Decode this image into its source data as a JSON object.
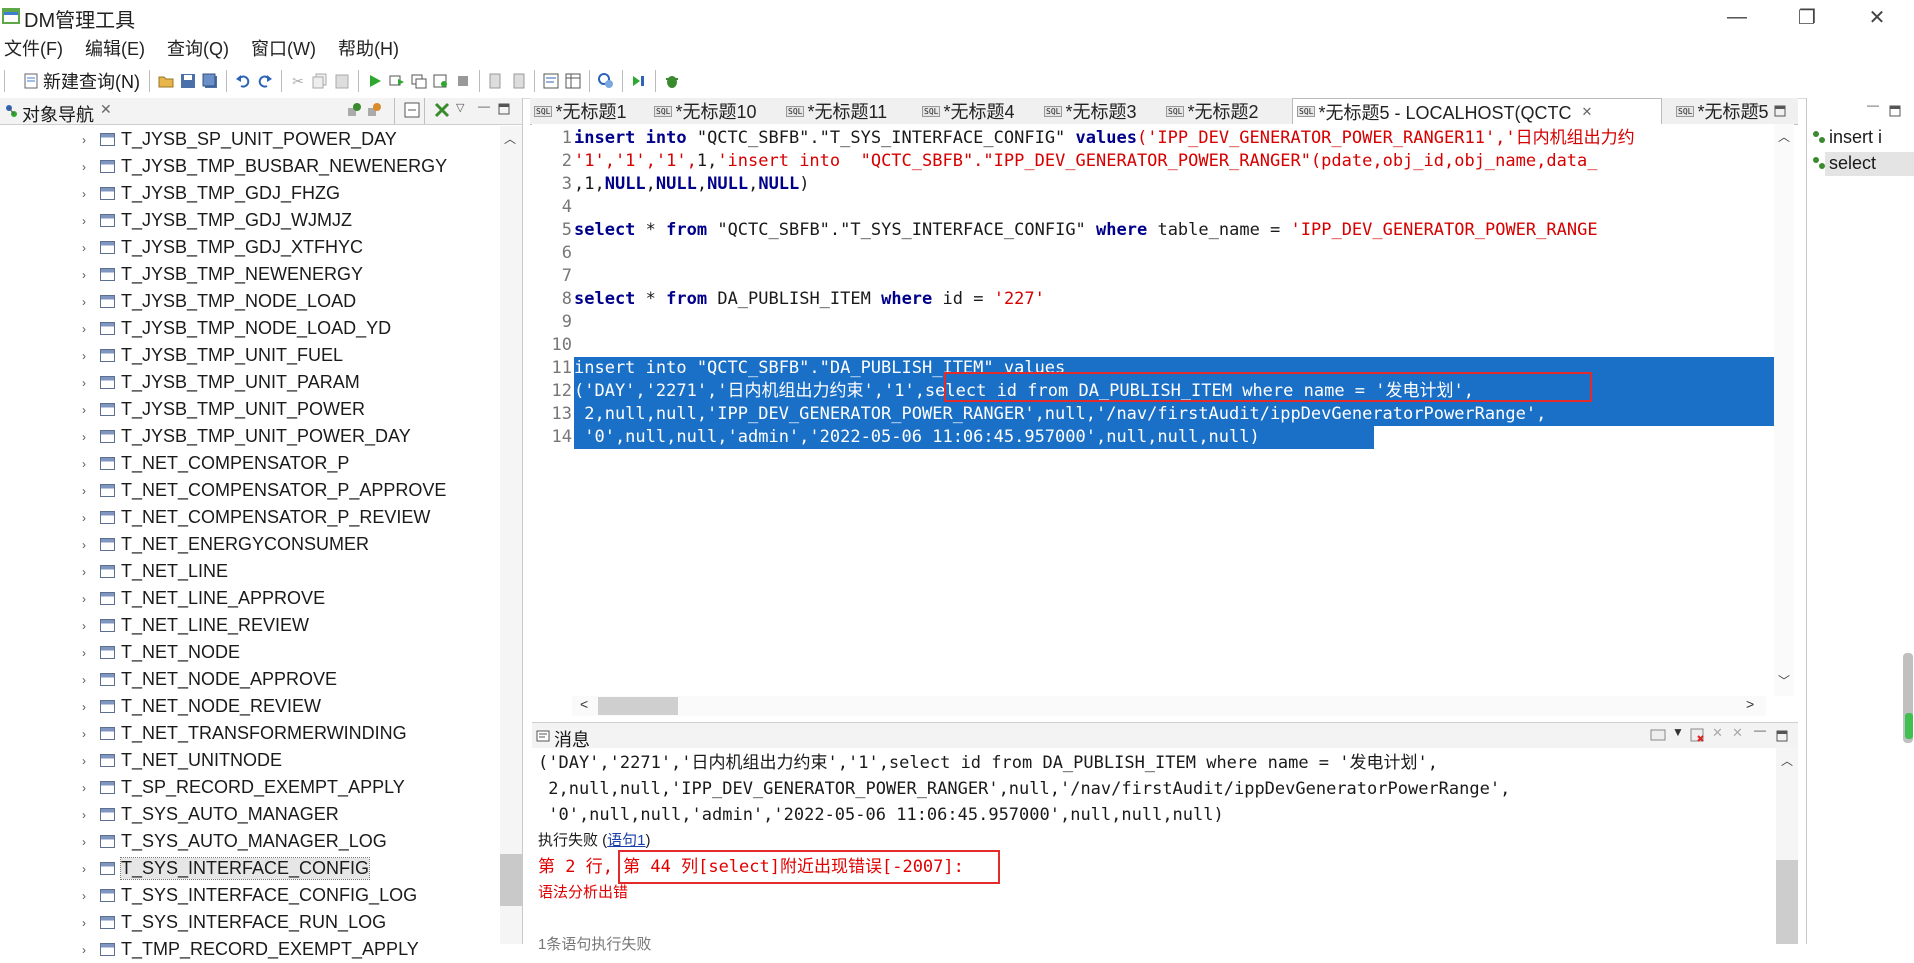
{
  "window": {
    "title": "DM管理工具",
    "controls": [
      "—",
      "❐",
      "✕"
    ]
  },
  "menu": [
    "文件(F)",
    "编辑(E)",
    "查询(Q)",
    "窗口(W)",
    "帮助(H)"
  ],
  "toolbar": {
    "new_query": "新建查询(N)"
  },
  "navigator": {
    "title": "对象导航",
    "items": [
      "T_JYSB_SP_UNIT_POWER_DAY",
      "T_JYSB_TMP_BUSBAR_NEWENERGY",
      "T_JYSB_TMP_GDJ_FHZG",
      "T_JYSB_TMP_GDJ_WJMJZ",
      "T_JYSB_TMP_GDJ_XTFHYC",
      "T_JYSB_TMP_NEWENERGY",
      "T_JYSB_TMP_NODE_LOAD",
      "T_JYSB_TMP_NODE_LOAD_YD",
      "T_JYSB_TMP_UNIT_FUEL",
      "T_JYSB_TMP_UNIT_PARAM",
      "T_JYSB_TMP_UNIT_POWER",
      "T_JYSB_TMP_UNIT_POWER_DAY",
      "T_NET_COMPENSATOR_P",
      "T_NET_COMPENSATOR_P_APPROVE",
      "T_NET_COMPENSATOR_P_REVIEW",
      "T_NET_ENERGYCONSUMER",
      "T_NET_LINE",
      "T_NET_LINE_APPROVE",
      "T_NET_LINE_REVIEW",
      "T_NET_NODE",
      "T_NET_NODE_APPROVE",
      "T_NET_NODE_REVIEW",
      "T_NET_TRANSFORMERWINDING",
      "T_NET_UNITNODE",
      "T_SP_RECORD_EXEMPT_APPLY",
      "T_SYS_AUTO_MANAGER",
      "T_SYS_AUTO_MANAGER_LOG",
      "T_SYS_INTERFACE_CONFIG",
      "T_SYS_INTERFACE_CONFIG_LOG",
      "T_SYS_INTERFACE_RUN_LOG",
      "T_TMP_RECORD_EXEMPT_APPLY"
    ],
    "selected_item": "T_SYS_INTERFACE_CONFIG"
  },
  "tabs": [
    "*无标题1",
    "*无标题10",
    "*无标题11",
    "*无标题4",
    "*无标题3",
    "*无标题2",
    "*无标题5 - LOCALHOST(QCTC",
    "*无标题5"
  ],
  "active_tab": "*无标题5 - LOCALHOST(QCTC",
  "editor": {
    "line_numbers": [
      "1",
      "2",
      "3",
      "4",
      "5",
      "6",
      "7",
      "8",
      "9",
      "10",
      "11",
      "12",
      "13",
      "14"
    ],
    "l1": {
      "kw1": "insert into",
      "t1": " \"QCTC_SBFB\".\"T_SYS_INTERFACE_CONFIG\" ",
      "kw2": "values",
      "s1": "('IPP_DEV_GENERATOR_POWER_RANGER11','日内机组出力约"
    },
    "l2": {
      "s1": "'1','1','1',",
      "t1": "1,",
      "s2": "'insert into  \"QCTC_SBFB\".\"IPP_DEV_GENERATOR_POWER_RANGER\"(pdate,obj_id,obj_name,data_"
    },
    "l3": {
      "t1": ",1,",
      "kw1": "NULL",
      "t2": ",",
      "kw2": "NULL",
      "t3": ",",
      "kw3": "NULL",
      "t4": ",",
      "kw4": "NULL",
      "t5": ")"
    },
    "l5": {
      "kw1": "select",
      "t1": " * ",
      "kw2": "from",
      "t2": " \"QCTC_SBFB\".\"T_SYS_INTERFACE_CONFIG\" ",
      "kw3": "where",
      "t3": " table_name = ",
      "s1": "'IPP_DEV_GENERATOR_POWER_RANGE"
    },
    "l8": {
      "kw1": "select",
      "t1": " * ",
      "kw2": "from",
      "t2": " DA_PUBLISH_ITEM ",
      "kw3": "where",
      "t3": " id = ",
      "s1": "'227'"
    },
    "l11": "insert into \"QCTC_SBFB\".\"DA_PUBLISH_ITEM\" values",
    "l12": "('DAY','2271','日内机组出力约束','1',select id from DA_PUBLISH_ITEM where name = '发电计划',",
    "l13": " 2,null,null,'IPP_DEV_GENERATOR_POWER_RANGER',null,'/nav/firstAudit/ippDevGeneratorPowerRange',",
    "l14": " '0',null,null,'admin','2022-05-06 11:06:45.957000',null,null,null)"
  },
  "messages": {
    "title": "消息",
    "lines": [
      "('DAY','2271','日内机组出力约束','1',select id from DA_PUBLISH_ITEM where name = '发电计划',",
      " 2,null,null,'IPP_DEV_GENERATOR_POWER_RANGER',null,'/nav/firstAudit/ippDevGeneratorPowerRange',",
      " '0',null,null,'admin','2022-05-06 11:06:45.957000',null,null,null)"
    ],
    "fail_prefix": "执行失败 (",
    "fail_link": "语句1",
    "fail_suffix": ")",
    "error_line": "第 2 行, 第 44 列[select]附近出现错误[-2007]:",
    "error_detail": "语法分析出错",
    "next_line": "1条语句执行失败"
  },
  "outline": [
    "insert i",
    "select"
  ],
  "colors": {
    "selection": "#1a6fc6",
    "keyword": "#00008b",
    "string": "#d60000",
    "error": "#e00000",
    "highlight_box": "#e32b2b"
  }
}
